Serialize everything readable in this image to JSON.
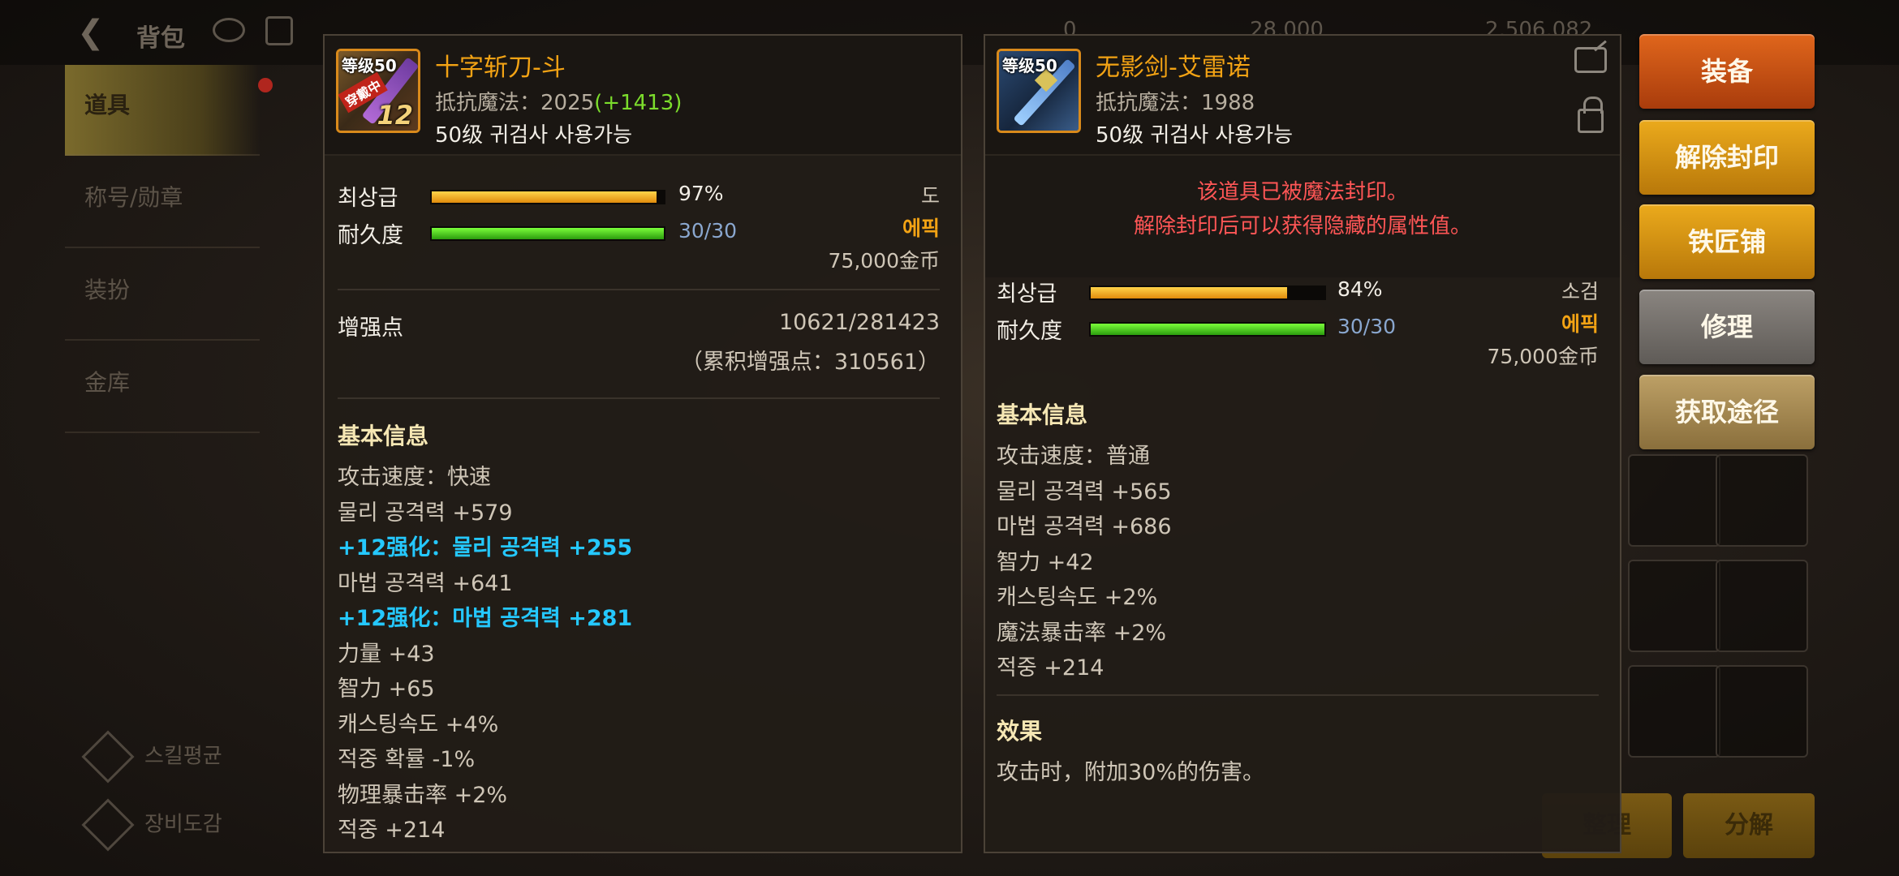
{
  "background": {
    "title": "背包",
    "sidebar_tabs": [
      "道具",
      "称号/勋章",
      "装扮",
      "金库"
    ],
    "sidebar_bottom": [
      "스킬평균",
      "장비도감"
    ],
    "currencies": [
      "0",
      "28,000",
      "2,506,082"
    ],
    "bottom_buttons": [
      "整理",
      "分解"
    ]
  },
  "left_item": {
    "name": "十字斩刀-斗",
    "resist_label": "抵抗魔法：2025",
    "resist_bonus": "(+1413)",
    "class_req": "50级 귀검사 사용가능",
    "icon_level": "等级50",
    "icon_equipped": "穿戴中",
    "icon_plus": "12",
    "grade_label": "최상급",
    "grade_value": "97%",
    "grade_fraction": 0.97,
    "durability_label": "耐久度",
    "durability_value": "30/30",
    "durability_fraction": 1.0,
    "weapon_type": "도",
    "rarity": "에픽",
    "price": "75,000金币",
    "enhance_label": "增强点",
    "enhance_value": "10621/281423",
    "enhance_total": "（累积增强点：310561）",
    "basic_info_title": "基本信息",
    "stats": [
      {
        "text": "攻击速度：快速",
        "highlight": false
      },
      {
        "text": "물리 공격력 +579",
        "highlight": false
      },
      {
        "text": "+12强化：물리 공격력 +255",
        "highlight": true
      },
      {
        "text": "마법 공격력 +641",
        "highlight": false
      },
      {
        "text": "+12强化：마법 공격력 +281",
        "highlight": true
      },
      {
        "text": "力量 +43",
        "highlight": false
      },
      {
        "text": "智力 +65",
        "highlight": false
      },
      {
        "text": "캐스팅속도 +4%",
        "highlight": false
      },
      {
        "text": "적중 확률 -1%",
        "highlight": false
      },
      {
        "text": "物理暴击率 +2%",
        "highlight": false
      },
      {
        "text": "적중 +214",
        "highlight": false
      }
    ]
  },
  "right_item": {
    "name": "无影剑-艾雷诺",
    "resist_label": "抵抗魔法：1988",
    "class_req": "50级 귀검사 사용가능",
    "icon_level": "等级50",
    "sealed_line1": "该道具已被魔法封印。",
    "sealed_line2": "解除封印后可以获得隐藏的属性值。",
    "grade_label": "최상급",
    "grade_value": "84%",
    "grade_fraction": 0.84,
    "durability_label": "耐久度",
    "durability_value": "30/30",
    "durability_fraction": 1.0,
    "weapon_type": "소검",
    "rarity": "에픽",
    "price": "75,000金币",
    "basic_info_title": "基本信息",
    "stats": [
      "攻击速度：普通",
      "물리 공격력 +565",
      "마법 공격력 +686",
      "智力 +42",
      "캐스팅속도 +2%",
      "魔法暴击率 +2%",
      "적중 +214"
    ],
    "effect_title": "效果",
    "effect_text": "攻击时，附加30%的伤害。"
  },
  "actions": {
    "equip": "装备",
    "unseal": "解除封印",
    "blacksmith": "铁匠铺",
    "repair": "修理",
    "obtain": "获取途径"
  },
  "colors": {
    "item_name": "#f3a314",
    "highlight_stat": "#25c8ff",
    "sealed_warning": "#ff5656",
    "bonus_green": "#7cdd2c"
  }
}
